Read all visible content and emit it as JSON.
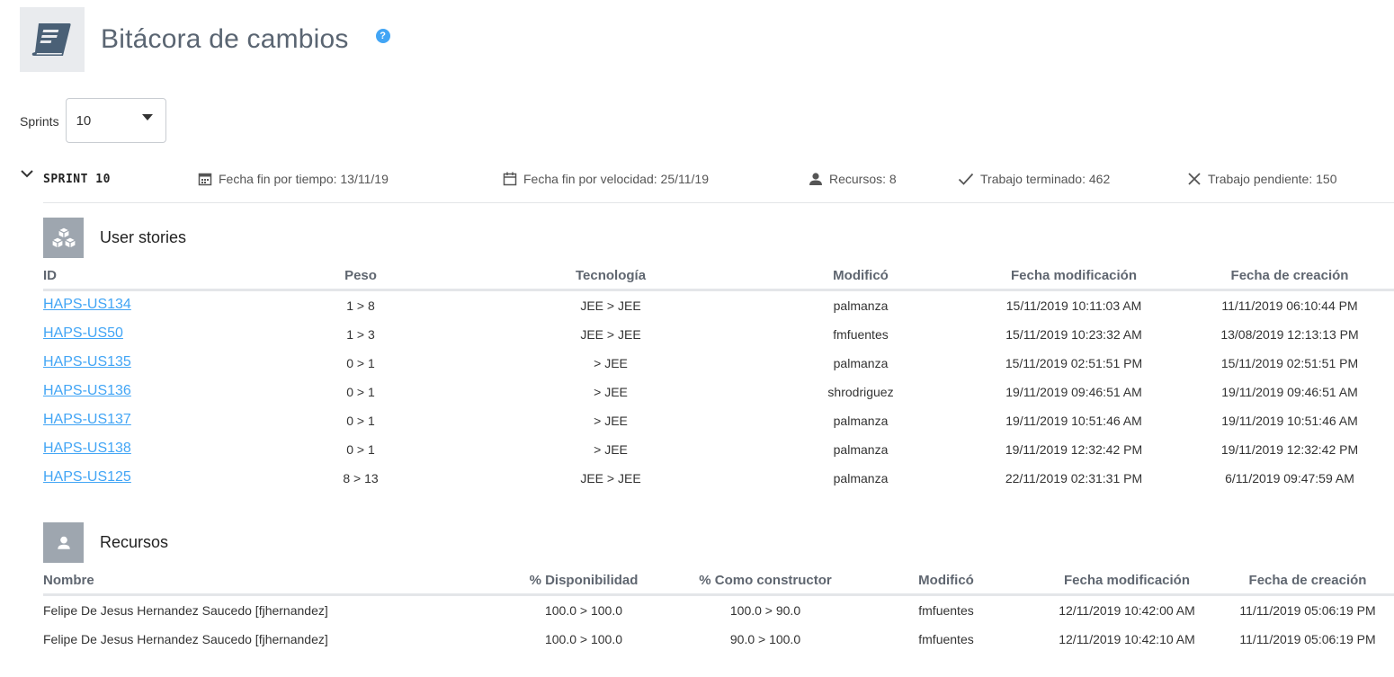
{
  "page": {
    "title": "Bitácora de cambios",
    "help_symbol": "?"
  },
  "sprint_selector": {
    "label": "Sprints",
    "value": "10"
  },
  "sprint": {
    "name": "SPRINT 10",
    "fecha_fin_tiempo": "Fecha fin por tiempo: 13/11/19",
    "fecha_fin_velocidad": "Fecha fin por velocidad: 25/11/19",
    "recursos": "Recursos: 8",
    "trabajo_terminado": "Trabajo terminado: 462",
    "trabajo_pendiente": "Trabajo pendiente: 150"
  },
  "user_stories": {
    "title": "User stories",
    "columns": [
      "ID",
      "Peso",
      "Tecnología",
      "Modificó",
      "Fecha modificación",
      "Fecha de creación"
    ],
    "rows": [
      [
        "HAPS-US134",
        "1 > 8",
        "JEE > JEE",
        "palmanza",
        "15/11/2019 10:11:03 AM",
        "11/11/2019 06:10:44 PM"
      ],
      [
        "HAPS-US50",
        "1 > 3",
        "JEE > JEE",
        "fmfuentes",
        "15/11/2019 10:23:32 AM",
        "13/08/2019 12:13:13 PM"
      ],
      [
        "HAPS-US135",
        "0 > 1",
        "> JEE",
        "palmanza",
        "15/11/2019 02:51:51 PM",
        "15/11/2019 02:51:51 PM"
      ],
      [
        "HAPS-US136",
        "0 > 1",
        "> JEE",
        "shrodriguez",
        "19/11/2019 09:46:51 AM",
        "19/11/2019 09:46:51 AM"
      ],
      [
        "HAPS-US137",
        "0 > 1",
        "> JEE",
        "palmanza",
        "19/11/2019 10:51:46 AM",
        "19/11/2019 10:51:46 AM"
      ],
      [
        "HAPS-US138",
        "0 > 1",
        "> JEE",
        "palmanza",
        "19/11/2019 12:32:42 PM",
        "19/11/2019 12:32:42 PM"
      ],
      [
        "HAPS-US125",
        "8 > 13",
        "JEE > JEE",
        "palmanza",
        "22/11/2019 02:31:31 PM",
        "6/11/2019 09:47:59 AM"
      ]
    ]
  },
  "recursos": {
    "title": "Recursos",
    "columns": [
      "Nombre",
      "% Disponibilidad",
      "% Como constructor",
      "Modificó",
      "Fecha modificación",
      "Fecha de creación"
    ],
    "rows": [
      [
        "Felipe De Jesus Hernandez Saucedo [fjhernandez]",
        "100.0 > 100.0",
        "100.0 > 90.0",
        "fmfuentes",
        "12/11/2019 10:42:00 AM",
        "11/11/2019 05:06:19 PM"
      ],
      [
        "Felipe De Jesus Hernandez Saucedo [fjhernandez]",
        "100.0 > 100.0",
        "90.0 > 100.0",
        "fmfuentes",
        "12/11/2019 10:42:10 AM",
        "11/11/2019 05:06:19 PM"
      ]
    ]
  },
  "colors": {
    "link": "#42a5f5",
    "icon_box": "#9ea6af",
    "header_box": "#e9ebee",
    "title": "#5a6572"
  }
}
